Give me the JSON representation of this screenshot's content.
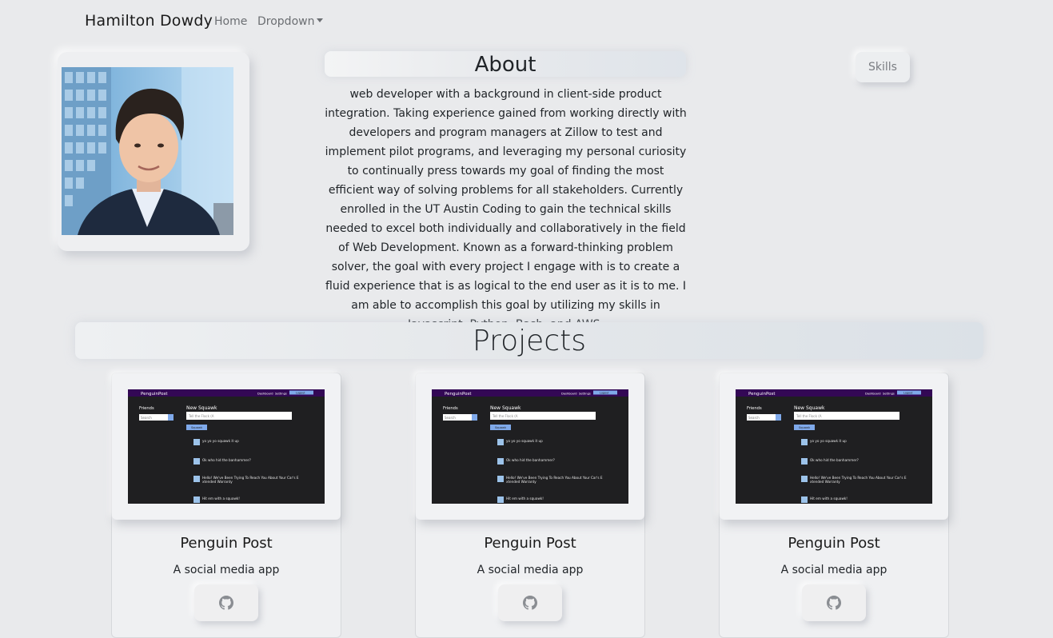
{
  "navbar": {
    "brand": "Hamilton Dowdy",
    "home": "Home",
    "dropdown": "Dropdown"
  },
  "about": {
    "title": "About",
    "text": "web developer with a background in client-side product integration. Taking experience gained from working directly with developers and program managers at Zillow to test and implement pilot programs, and leveraging my personal curiosity to continually press towards my goal of finding the most efficient way of solving problems for all stakeholders. Currently enrolled in the UT Austin Coding to gain the technical skills needed to excel both individually and collaboratively in the field of Web Development. Known as a forward-thinking problem solver, the goal with every project I engage with is to create a fluid experience that is as logical to the end user as it is to me. I am able to accomplish this goal by utilizing my skills in Javascript, Python, Bash, and AWS."
  },
  "skills_button": "Skills",
  "projects": {
    "title": "Projects",
    "items": [
      {
        "name": "Penguin Post",
        "description": "A social media app",
        "icon": "github-icon"
      },
      {
        "name": "Penguin Post",
        "description": "A social media app",
        "icon": "github-icon"
      },
      {
        "name": "Penguin Post",
        "description": "A social media app",
        "icon": "github-icon"
      }
    ]
  },
  "screenshot": {
    "app": "PenguinPost",
    "nav": [
      "Dashboard",
      "Settings",
      "Logout"
    ],
    "friends_label": "Friends",
    "search_placeholder": "Search",
    "compose_title": "New Squawk",
    "compose_placeholder": "Tell the Flock (A",
    "post_button": "Squawk",
    "posts": [
      "yo yo yo squawk it up",
      "Ok who hid the banhammer?",
      "Hello! We've Been Trying To Reach You About Your Car's Extended Warranty",
      "Hit em with a squawk!"
    ],
    "colors": {
      "header": "#330855",
      "body": "#1f1f21",
      "accent": "#7fa9ea"
    }
  }
}
